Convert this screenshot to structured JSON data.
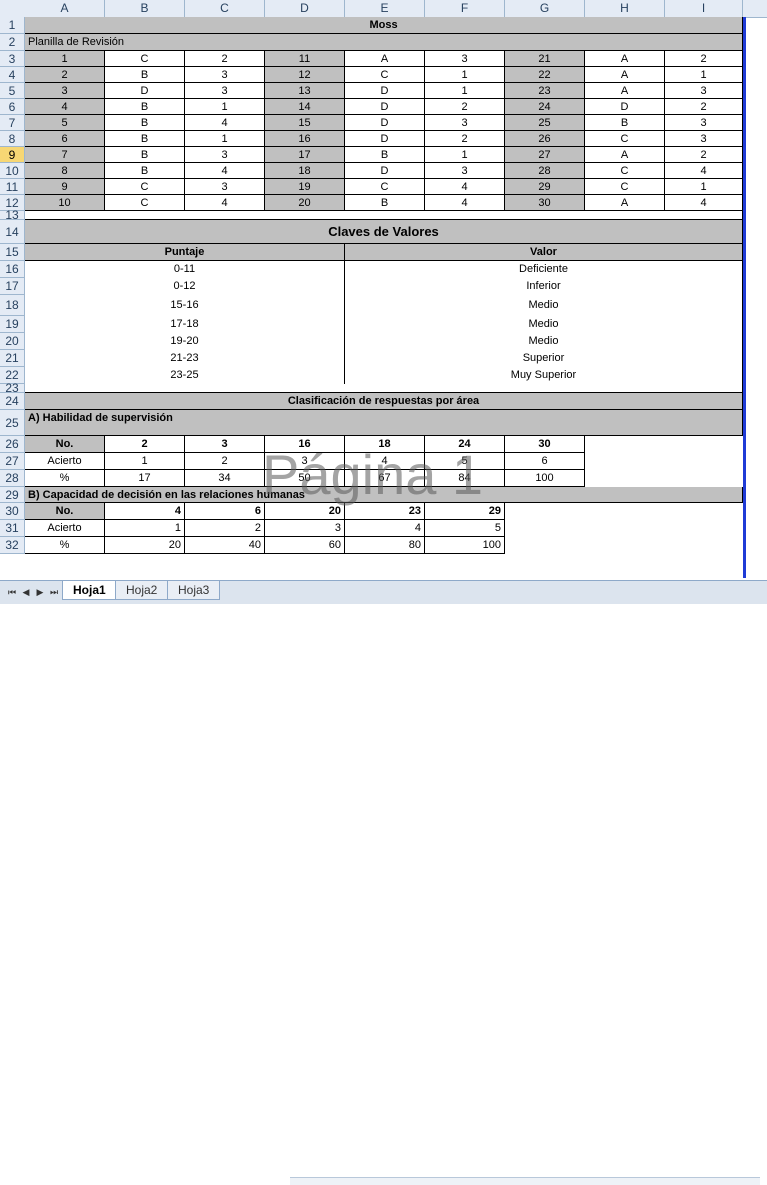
{
  "columns": [
    "A",
    "B",
    "C",
    "D",
    "E",
    "F",
    "G",
    "H",
    "I"
  ],
  "rows": [
    "1",
    "2",
    "3",
    "4",
    "5",
    "6",
    "7",
    "8",
    "9",
    "10",
    "11",
    "12",
    "13",
    "14",
    "15",
    "16",
    "17",
    "18",
    "19",
    "20",
    "21",
    "22",
    "23",
    "24",
    "25",
    "26",
    "27",
    "28",
    "29",
    "30",
    "31",
    "32"
  ],
  "title": "Moss",
  "subtitle": "Planilla de Revisión",
  "review_rows": [
    [
      "1",
      "C",
      "2",
      "11",
      "A",
      "3",
      "21",
      "A",
      "2"
    ],
    [
      "2",
      "B",
      "3",
      "12",
      "C",
      "1",
      "22",
      "A",
      "1"
    ],
    [
      "3",
      "D",
      "3",
      "13",
      "D",
      "1",
      "23",
      "A",
      "3"
    ],
    [
      "4",
      "B",
      "1",
      "14",
      "D",
      "2",
      "24",
      "D",
      "2"
    ],
    [
      "5",
      "B",
      "4",
      "15",
      "D",
      "3",
      "25",
      "B",
      "3"
    ],
    [
      "6",
      "B",
      "1",
      "16",
      "D",
      "2",
      "26",
      "C",
      "3"
    ],
    [
      "7",
      "B",
      "3",
      "17",
      "B",
      "1",
      "27",
      "A",
      "2"
    ],
    [
      "8",
      "B",
      "4",
      "18",
      "D",
      "3",
      "28",
      "C",
      "4"
    ],
    [
      "9",
      "C",
      "3",
      "19",
      "C",
      "4",
      "29",
      "C",
      "1"
    ],
    [
      "10",
      "C",
      "4",
      "20",
      "B",
      "4",
      "30",
      "A",
      "4"
    ]
  ],
  "claves": {
    "title": "Claves de Valores",
    "col_puntaje": "Puntaje",
    "col_valor": "Valor",
    "rows": [
      [
        "0-11",
        "Deficiente"
      ],
      [
        "0-12",
        "Inferior"
      ],
      [
        "15-16",
        "Medio"
      ],
      [
        "17-18",
        "Medio"
      ],
      [
        "19-20",
        "Medio"
      ],
      [
        "21-23",
        "Superior"
      ],
      [
        "23-25",
        "Muy Superior"
      ]
    ]
  },
  "clasificacion_title": "Clasificación de respuestas por área",
  "section_a": {
    "title": "A)  Habilidad de supervisión",
    "labels": [
      "No.",
      "Acierto",
      "%"
    ],
    "no": [
      "2",
      "3",
      "16",
      "18",
      "24",
      "30"
    ],
    "acierto": [
      "1",
      "2",
      "3",
      "4",
      "5",
      "6"
    ],
    "pct": [
      "17",
      "34",
      "50",
      "67",
      "84",
      "100"
    ]
  },
  "section_b": {
    "title": "B)  Capacidad de decisión en las relaciones humanas",
    "labels": [
      "No.",
      "Acierto",
      "%"
    ],
    "no": [
      "4",
      "6",
      "20",
      "23",
      "29"
    ],
    "acierto": [
      "1",
      "2",
      "3",
      "4",
      "5"
    ],
    "pct": [
      "20",
      "40",
      "60",
      "80",
      "100"
    ]
  },
  "watermark": "Página 1",
  "tabs": [
    "Hoja1",
    "Hoja2",
    "Hoja3"
  ],
  "active_tab": "Hoja1"
}
